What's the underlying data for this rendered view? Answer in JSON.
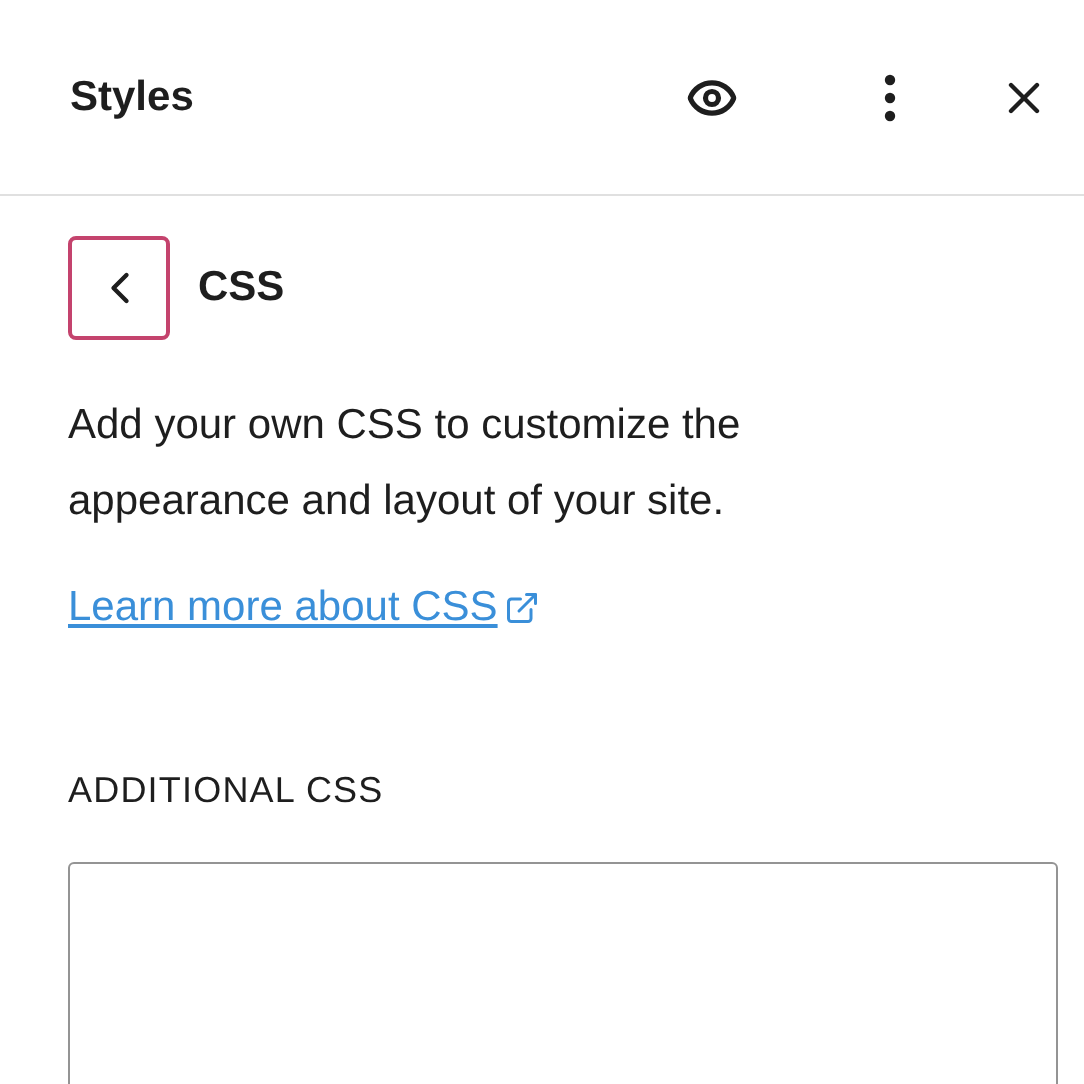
{
  "header": {
    "title": "Styles"
  },
  "panel": {
    "title": "CSS",
    "description": "Add your own CSS to customize the appearance and layout of your site.",
    "link": "Learn more about CSS",
    "field_label": "ADDITIONAL CSS"
  }
}
